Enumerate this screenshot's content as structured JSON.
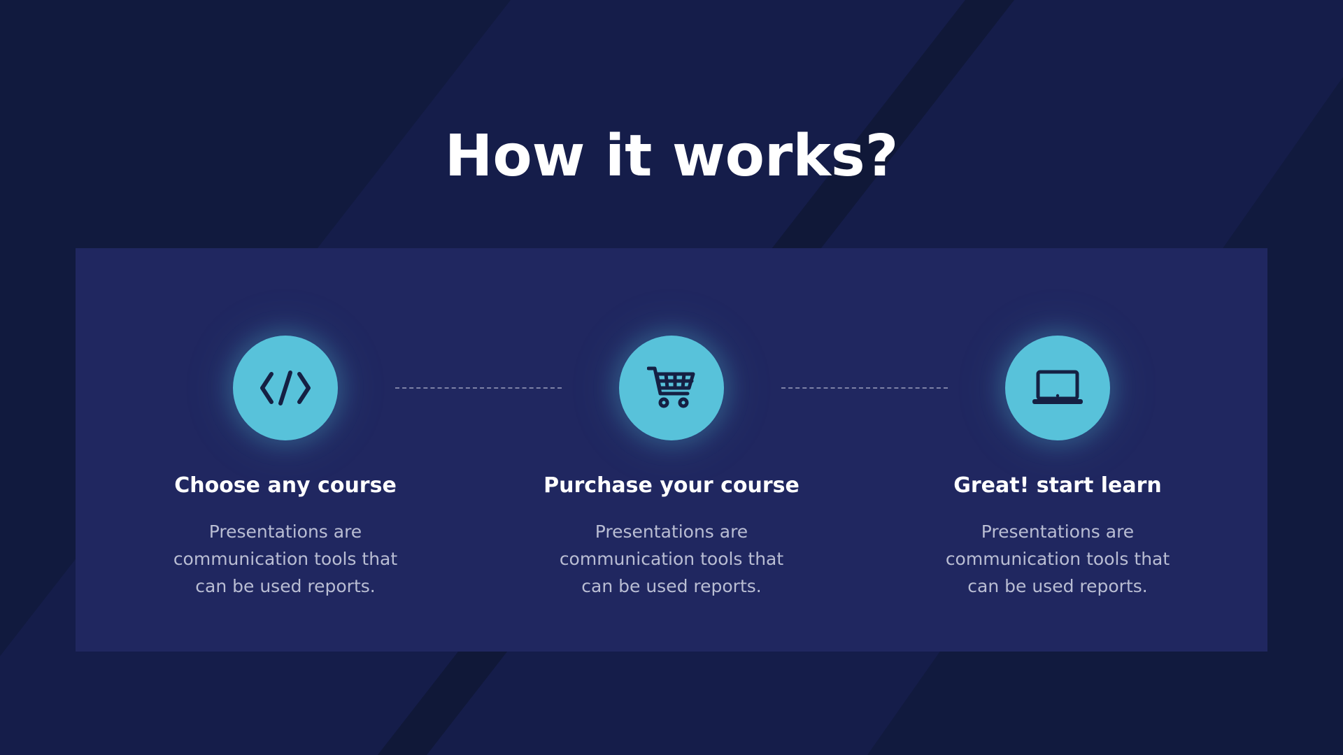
{
  "page": {
    "title": "How it works?",
    "colors": {
      "background": "#111a3e",
      "panel": "#202760",
      "accent": "#58c2da",
      "icon": "#152043",
      "title_text": "#ffffff",
      "body_text": "#b9bdd3"
    }
  },
  "steps": [
    {
      "icon": "code-icon",
      "title": "Choose any course",
      "description": "Presentations are communication tools that can be used reports."
    },
    {
      "icon": "shopping-cart-icon",
      "title": "Purchase your course",
      "description": "Presentations are communication tools that can be used reports."
    },
    {
      "icon": "laptop-icon",
      "title": "Great! start learn",
      "description": "Presentations are communication tools that can be used reports."
    }
  ]
}
